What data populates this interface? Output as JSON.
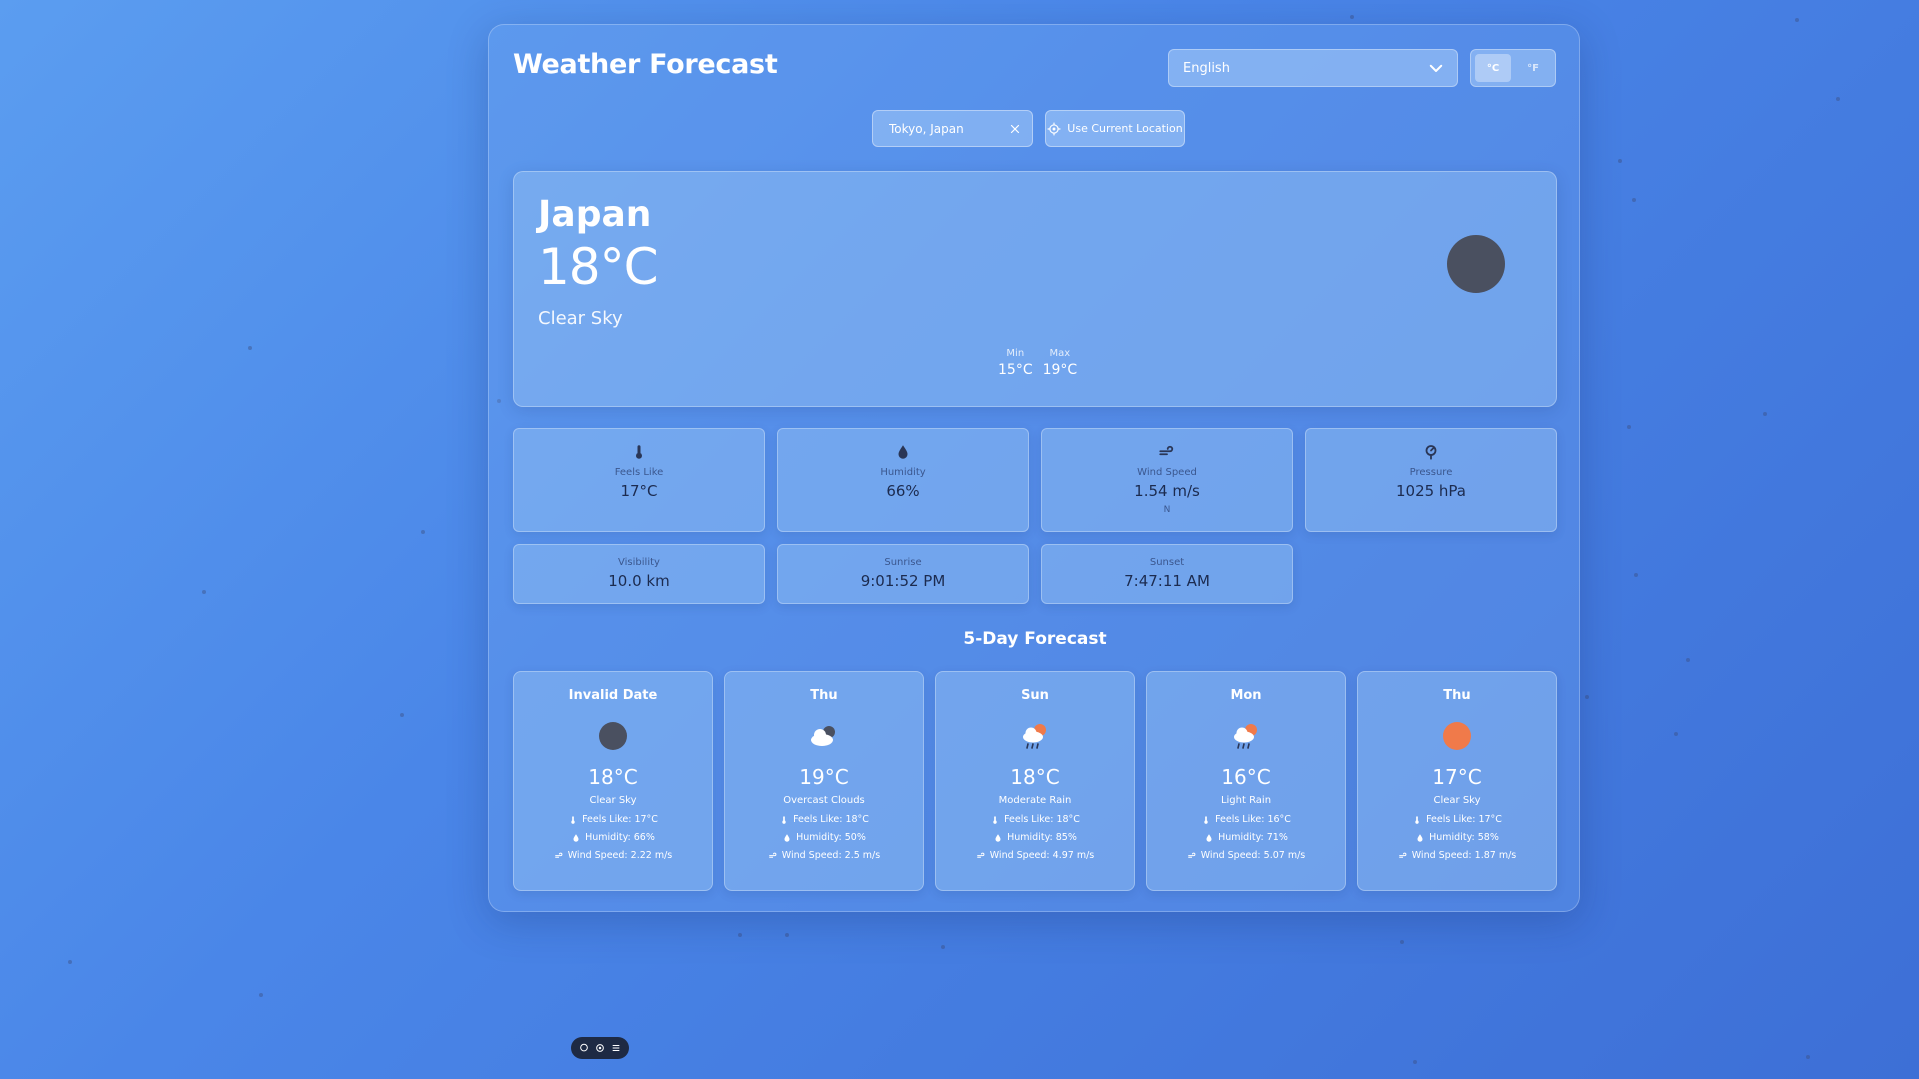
{
  "app": {
    "title": "Weather Forecast"
  },
  "language": {
    "selected": "English"
  },
  "units": {
    "celsius": "°C",
    "fahrenheit": "°F"
  },
  "search": {
    "value": "Tokyo, Japan",
    "use_location_label": "Use Current Location"
  },
  "current": {
    "city": "Japan",
    "temp": "18°C",
    "condition": "Clear Sky",
    "min_label": "Min",
    "min_value": "15°C",
    "max_label": "Max",
    "max_value": "19°C"
  },
  "stats": {
    "feels_like": {
      "label": "Feels Like",
      "value": "17°C"
    },
    "humidity": {
      "label": "Humidity",
      "value": "66%"
    },
    "wind": {
      "label": "Wind Speed",
      "value": "1.54 m/s",
      "direction": "N"
    },
    "pressure": {
      "label": "Pressure",
      "value": "1025 hPa"
    },
    "visibility": {
      "label": "Visibility",
      "value": "10.0 km"
    },
    "sunrise": {
      "label": "Sunrise",
      "value": "9:01:52 PM"
    },
    "sunset": {
      "label": "Sunset",
      "value": "7:47:11 AM"
    }
  },
  "forecast": {
    "title": "5-Day Forecast",
    "days": [
      {
        "day": "Invalid Date",
        "icon": "dark-circle-icon",
        "temp": "18°C",
        "condition": "Clear Sky",
        "feels": "Feels Like: 17°C",
        "humidity": "Humidity: 66%",
        "wind": "Wind Speed: 2.22 m/s"
      },
      {
        "day": "Thu",
        "icon": "overcast-clouds-icon",
        "temp": "19°C",
        "condition": "Overcast Clouds",
        "feels": "Feels Like: 18°C",
        "humidity": "Humidity: 50%",
        "wind": "Wind Speed: 2.5 m/s"
      },
      {
        "day": "Sun",
        "icon": "rain-cloud-sun-icon",
        "temp": "18°C",
        "condition": "Moderate Rain",
        "feels": "Feels Like: 18°C",
        "humidity": "Humidity: 85%",
        "wind": "Wind Speed: 4.97 m/s"
      },
      {
        "day": "Mon",
        "icon": "rain-cloud-sun-icon",
        "temp": "16°C",
        "condition": "Light Rain",
        "feels": "Feels Like: 16°C",
        "humidity": "Humidity: 71%",
        "wind": "Wind Speed: 5.07 m/s"
      },
      {
        "day": "Thu",
        "icon": "sun-icon",
        "temp": "17°C",
        "condition": "Clear Sky",
        "feels": "Feels Like: 17°C",
        "humidity": "Humidity: 58%",
        "wind": "Wind Speed: 1.87 m/s"
      }
    ]
  },
  "colors": {
    "accent_sun": "#f07a4a",
    "dark_icon": "#4a5060",
    "text_dark": "#1c2b4f"
  }
}
